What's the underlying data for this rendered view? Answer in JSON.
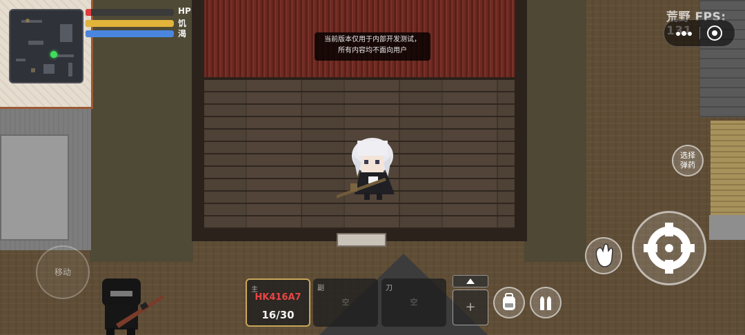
{
  "hud": {
    "stats": {
      "hp_label": "HP",
      "hunger_label": "饥",
      "thirst_label": "渴",
      "hp_value": 0,
      "hunger_value": 1.0,
      "thirst_value": 1.0,
      "hp_color": "#e23b3b",
      "hunger_color": "#e2b43a",
      "thirst_color": "#4a86e0"
    },
    "notice": {
      "line1": "当前版本仅用于内部开发测试，",
      "line2": "所有内容均不面向用户"
    },
    "overlay": {
      "fps_text": "荒野 FPS: 131"
    },
    "buttons": {
      "select_ammo_label": "选择弹药",
      "move_label": "移动"
    },
    "weapons": {
      "main_tag": "主",
      "main_name": "HK416A7",
      "main_ammo": "16/30",
      "secondary_tag": "副",
      "secondary_value": "空",
      "knife_tag": "刀",
      "knife_value": "空"
    }
  },
  "icons": [
    "more-icon",
    "target-icon",
    "chevron-up-icon",
    "plus-icon",
    "backpack-icon",
    "bullets-icon",
    "hand-icon",
    "crosshair-icon"
  ],
  "colors": {
    "accent_gold": "#c9a75a",
    "weapon_red": "#e84646",
    "minimap_player": "#3ee05b"
  }
}
